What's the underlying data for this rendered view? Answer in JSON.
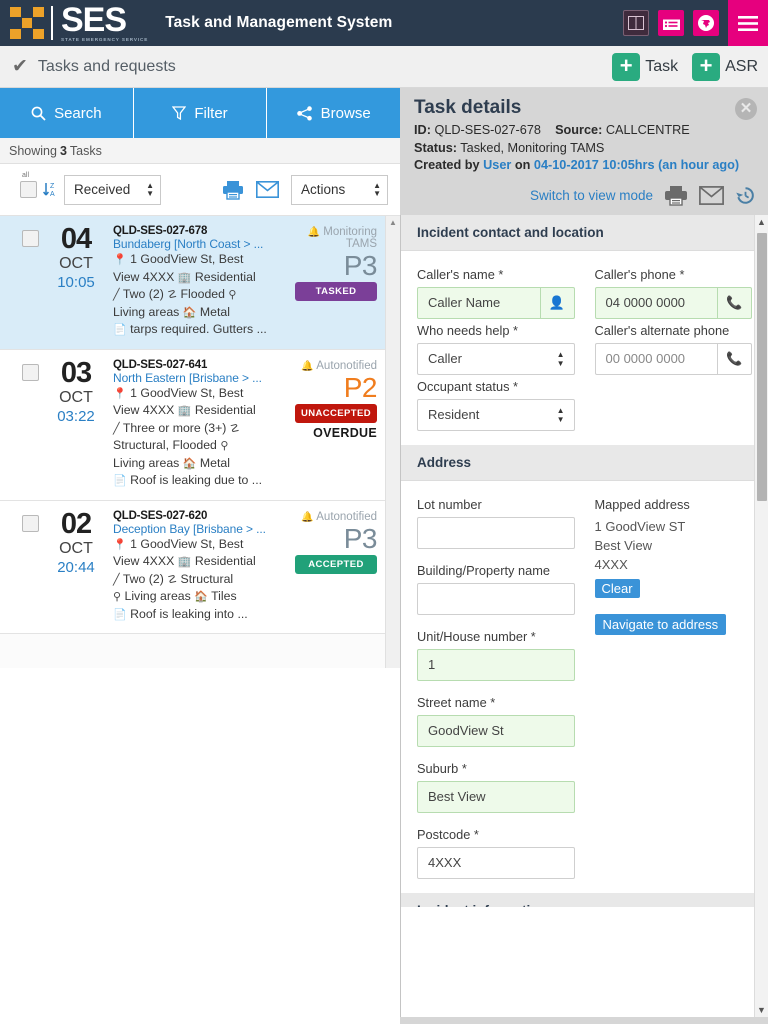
{
  "header": {
    "brand": "SES",
    "brand_sub": "STATE EMERGENCY SERVICE",
    "app_title": "Task and Management System",
    "icons": [
      "split-pane-icon",
      "list-view-icon",
      "globe-icon",
      "hamburger-menu-icon"
    ]
  },
  "subheader": {
    "title": "Tasks and requests",
    "check_icon": "✔",
    "add_task_label": "Task",
    "add_asr_label": "ASR",
    "plus": "+"
  },
  "tabs": [
    {
      "label": "Search",
      "icon": "search-icon"
    },
    {
      "label": "Filter",
      "icon": "filter-icon"
    },
    {
      "label": "Browse",
      "icon": "share-icon"
    }
  ],
  "showing": {
    "prefix": "Showing",
    "count": "3",
    "suffix": "Tasks"
  },
  "listtools": {
    "select_all_label": "all",
    "sort_icon": "sort-za-icon",
    "sort_value": "Received",
    "print_icon": "printer-icon",
    "email_icon": "envelope-icon",
    "actions_value": "Actions"
  },
  "tasks": [
    {
      "selected": true,
      "day": "04",
      "month": "OCT",
      "time": "10:05",
      "id": "QLD-SES-027-678",
      "region": "Bundaberg [North Coast > ...",
      "address_line1": "1 GoodView St, Best",
      "address_line2": "View 4XXX",
      "property_type": "Residential",
      "storeys": "Two (2)",
      "damage": "Flooded",
      "area": "Living areas",
      "roof": "Metal",
      "note": "tarps required. Gutters ...",
      "notify": "Monitoring TAMS",
      "priority": "P3",
      "priority_class": "p3",
      "badge": "TASKED",
      "badge_class": "tasked",
      "overdue": ""
    },
    {
      "selected": false,
      "day": "03",
      "month": "OCT",
      "time": "03:22",
      "id": "QLD-SES-027-641",
      "region": "North Eastern [Brisbane > ...",
      "address_line1": "1 GoodView St, Best",
      "address_line2": "View 4XXX",
      "property_type": "Residential",
      "storeys": "Three or more (3+)",
      "damage": "Structural, Flooded",
      "area": "Living areas",
      "roof": "Metal",
      "note": "Roof is leaking due to ...",
      "notify": "Autonotified",
      "priority": "P2",
      "priority_class": "p2",
      "badge": "UNACCEPTED",
      "badge_class": "unaccepted",
      "overdue": "OVERDUE"
    },
    {
      "selected": false,
      "day": "02",
      "month": "OCT",
      "time": "20:44",
      "id": "QLD-SES-027-620",
      "region": "Deception Bay [Brisbane > ...",
      "address_line1": "1 GoodView St, Best",
      "address_line2": "View 4XXX",
      "property_type": "Residential",
      "storeys": "Two (2)",
      "damage": "Structural",
      "area": "Living areas",
      "roof": "Tiles",
      "note": "Roof is leaking into ...",
      "notify": "Autonotified",
      "priority": "P3",
      "priority_class": "p3",
      "badge": "ACCEPTED",
      "badge_class": "accepted",
      "overdue": ""
    }
  ],
  "details": {
    "title": "Task details",
    "id_label": "ID:",
    "id_value": "QLD-SES-027-678",
    "source_label": "Source:",
    "source_value": "CALLCENTRE",
    "status_label": "Status:",
    "status_value": "Tasked, Monitoring TAMS",
    "created_label": "Created by",
    "created_user": "User",
    "created_on": "on",
    "created_datetime": "04-10-2017 10:05hrs",
    "created_ago": "(an hour ago)",
    "switch_link": "Switch to view mode",
    "close_icon": "close-icon",
    "action_icons": [
      "printer-icon",
      "envelope-icon",
      "history-icon"
    ]
  },
  "sections": {
    "contact": {
      "heading": "Incident contact and location",
      "callers_name_label": "Caller's name *",
      "callers_name_value": "Caller Name",
      "callers_phone_label": "Caller's phone *",
      "callers_phone_value": "04 0000 0000",
      "who_needs_help_label": "Who needs help *",
      "who_needs_help_value": "Caller",
      "alt_phone_label": "Caller's alternate phone",
      "alt_phone_value": "00 0000 0000",
      "occupant_status_label": "Occupant status *",
      "occupant_status_value": "Resident"
    },
    "address": {
      "heading": "Address",
      "lot_number_label": "Lot number",
      "lot_number_value": "",
      "building_label": "Building/Property name",
      "building_value": "",
      "unit_label": "Unit/House number *",
      "unit_value": "1",
      "street_label": "Street name *",
      "street_value": "GoodView St",
      "suburb_label": "Suburb *",
      "suburb_value": "Best View",
      "postcode_label": "Postcode *",
      "postcode_value": "4XXX",
      "mapped_label": "Mapped address",
      "mapped_line1": "1 GoodView ST",
      "mapped_line2": "Best View",
      "mapped_line3": "4XXX",
      "clear_label": "Clear",
      "navigate_label": "Navigate to address"
    },
    "next_section_heading": "Incident information"
  },
  "colors": {
    "brand_dark": "#2b3b4e",
    "brand_orange": "#eda229",
    "pink": "#e6007e",
    "blue": "#3399dd",
    "green": "#2aab80",
    "purple": "#7b3f98",
    "red": "#c0170d",
    "teal": "#21a179",
    "p2_orange": "#f07d1e"
  }
}
